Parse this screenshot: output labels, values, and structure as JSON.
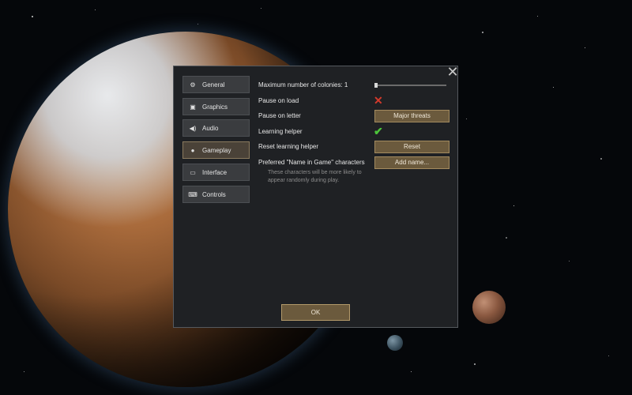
{
  "nav": {
    "items": [
      {
        "label": "General",
        "icon": "gear-icon"
      },
      {
        "label": "Graphics",
        "icon": "graphics-icon"
      },
      {
        "label": "Audio",
        "icon": "speaker-icon"
      },
      {
        "label": "Gameplay",
        "icon": "person-icon"
      },
      {
        "label": "Interface",
        "icon": "monitor-icon"
      },
      {
        "label": "Controls",
        "icon": "keyboard-icon"
      }
    ],
    "active": "Gameplay"
  },
  "settings": {
    "max_colonies_label": "Maximum number of colonies: 1",
    "max_colonies_value": 1,
    "pause_on_load_label": "Pause on load",
    "pause_on_load_enabled": false,
    "pause_on_letter_label": "Pause on letter",
    "pause_on_letter_value": "Major threats",
    "learning_helper_label": "Learning helper",
    "learning_helper_enabled": true,
    "reset_learning_label": "Reset learning helper",
    "reset_button": "Reset",
    "preferred_names_label": "Preferred \"Name in Game\" characters",
    "preferred_names_hint": "These characters will be more likely to appear randomly during play.",
    "add_name_button": "Add name..."
  },
  "dialog": {
    "ok_button": "OK",
    "close_glyph": "✕"
  },
  "colors": {
    "accent_gold": "#6b5a3d",
    "cross_red": "#d33a2c",
    "check_green": "#4cc43a"
  }
}
